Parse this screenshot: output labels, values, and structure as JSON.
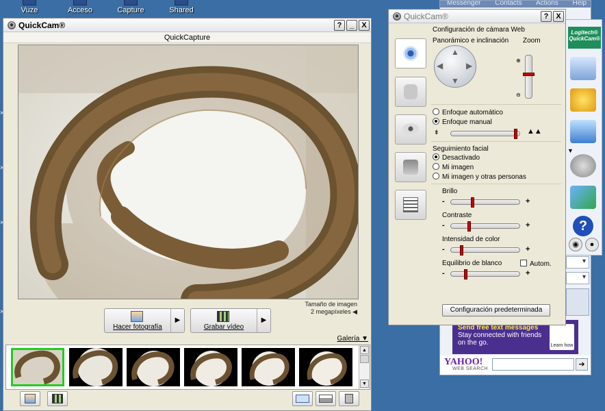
{
  "desktop": {
    "icons": [
      {
        "label": "Vuze"
      },
      {
        "label": "Acceso"
      },
      {
        "label": "Capture"
      },
      {
        "label": "Shared"
      }
    ]
  },
  "messenger_bg": {
    "menu": [
      "Messenger",
      "Contacts",
      "Actions",
      "Help"
    ],
    "ad": {
      "line1": "Send free text messages",
      "line2": "Stay connected with friends",
      "line3": "on the go.",
      "cta": "Learn how"
    },
    "yahoo": {
      "logo": "YAHOO!",
      "sub": "WEB SEARCH",
      "go": "➔"
    }
  },
  "logitech": {
    "brand_line1": "Logitech®",
    "brand_line2": "QuickCam®"
  },
  "main_window": {
    "title": "QuickCam®",
    "subtitle": "QuickCapture",
    "image_size_label": "Tamaño de imagen",
    "image_size_value": "2 megapíxeles",
    "take_photo_label": "Hacer fotografía",
    "record_video_label": "Grabar vídeo",
    "gallery_label": "Galería",
    "title_buttons": {
      "help": "?",
      "min": "_",
      "close": "X"
    }
  },
  "settings_window": {
    "title": "QuickCam®",
    "section_title": "Configuración de cámara Web",
    "pan_tilt_label": "Panorámico e inclinación",
    "zoom_label": "Zoom",
    "zoom_level": 0.55,
    "focus": {
      "auto_label": "Enfoque automático",
      "manual_label": "Enfoque manual",
      "selected": "manual",
      "level": 0.95
    },
    "face_tracking": {
      "title": "Seguimiento facial",
      "options": [
        "Desactivado",
        "Mi imagen",
        "Mi imagen y otras personas"
      ],
      "selected_index": 0
    },
    "brightness": {
      "label": "Brillo",
      "level": 0.32
    },
    "contrast": {
      "label": "Contraste",
      "level": 0.27
    },
    "color_intensity": {
      "label": "Intensidad de color",
      "level": 0.16
    },
    "white_balance": {
      "label": "Equilibrio de blanco",
      "level": 0.22,
      "auto_label": "Autom."
    },
    "minus": "-",
    "plus": "+",
    "reset_label": "Configuración predeterminada",
    "title_buttons": {
      "help": "?",
      "close": "X"
    }
  },
  "colors": {
    "desktop": "#3a6ea5",
    "window": "#ece9d8",
    "slider_knob": "#cc0000",
    "thumb_selected": "#22cc22",
    "logitech_green": "#1e8e5a"
  }
}
